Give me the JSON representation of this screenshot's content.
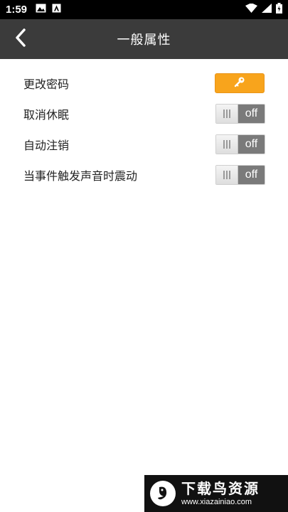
{
  "status_bar": {
    "time": "1:59"
  },
  "header": {
    "title": "一般属性"
  },
  "settings": [
    {
      "label": "更改密码",
      "control": "button",
      "icon": "key-icon"
    },
    {
      "label": "取消休眠",
      "control": "toggle",
      "state": "off"
    },
    {
      "label": "自动注销",
      "control": "toggle",
      "state": "off"
    },
    {
      "label": "当事件触发声音时震动",
      "control": "toggle",
      "state": "off"
    }
  ],
  "watermark": {
    "title": "下载鸟资源",
    "url": "www.xiazainiao.com"
  },
  "colors": {
    "status_bar": "#000000",
    "app_bar": "#3b3b3b",
    "accent_button": "#f8a41c",
    "toggle_off": "#7a7a7a"
  }
}
